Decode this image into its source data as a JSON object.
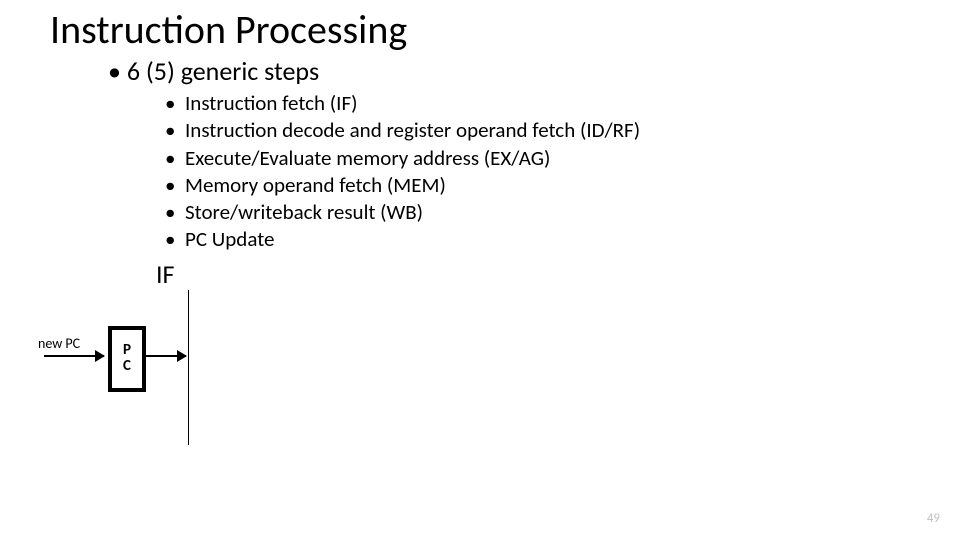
{
  "title": "Instruction Processing",
  "subtitle_bullet": "•",
  "subtitle": "6 (5) generic steps",
  "steps": [
    "Instruction fetch (IF)",
    "Instruction decode and register operand fetch (ID/RF)",
    "Execute/Evaluate memory address (EX/AG)",
    "Memory operand fetch (MEM)",
    "Store/writeback result (WB)",
    "PC Update"
  ],
  "stage_label": "IF",
  "newpc_label": "new PC",
  "pc_box_line1": "P",
  "pc_box_line2": "C",
  "page_number": "49",
  "bullet": "•"
}
